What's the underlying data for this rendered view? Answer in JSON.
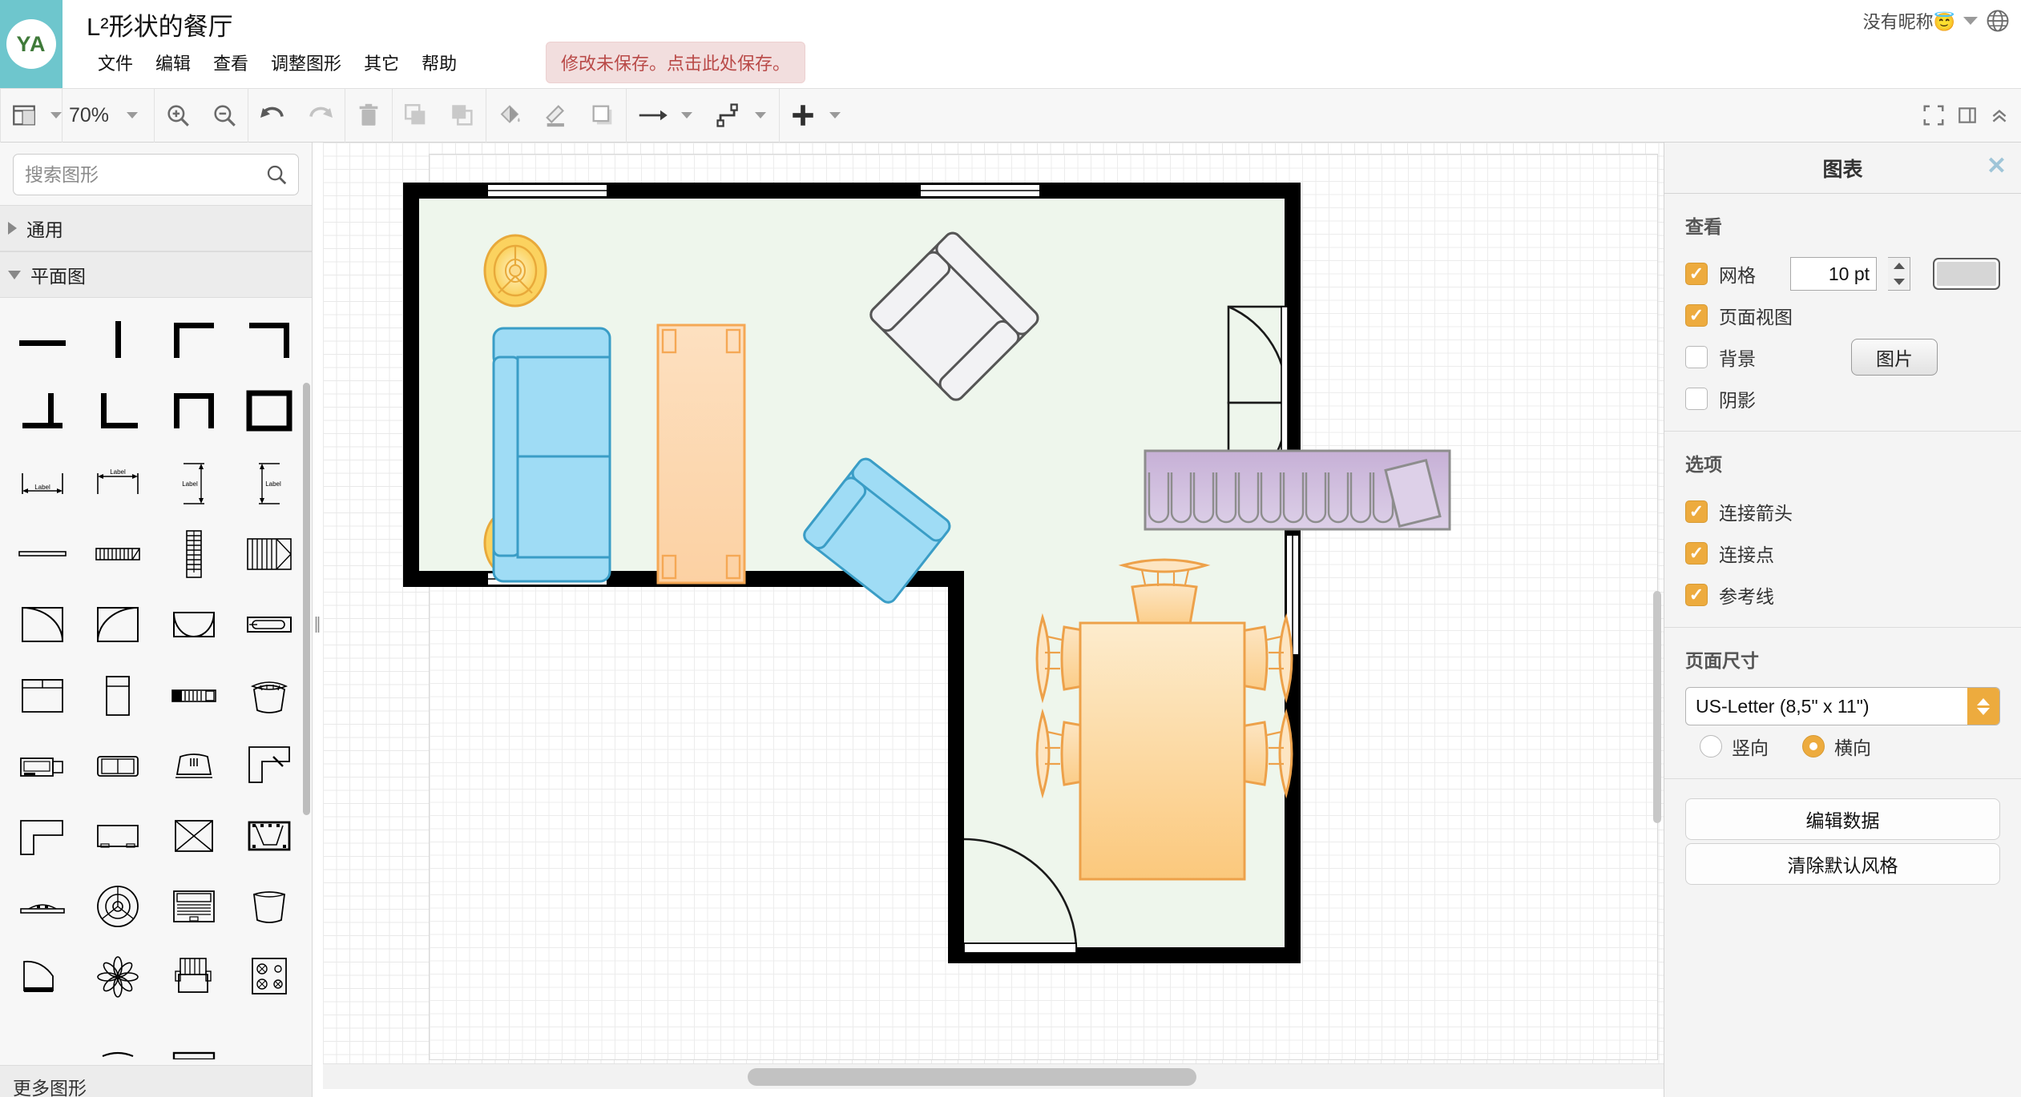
{
  "header": {
    "logo_initials": "YA",
    "doc_title": "L²形状的餐厅",
    "menu": [
      "文件",
      "编辑",
      "查看",
      "调整图形",
      "其它",
      "帮助"
    ],
    "save_notice": "修改未保存。点击此处保存。",
    "user_name": "没有昵称😇"
  },
  "toolbar": {
    "zoom_level": "70%",
    "icons": [
      "view-layout-icon",
      "zoom-in-icon",
      "zoom-out-icon",
      "undo-icon",
      "redo-icon",
      "delete-icon",
      "bring-to-front-icon",
      "send-to-back-icon",
      "fill-color-icon",
      "line-color-icon",
      "shadow-icon",
      "connection-arrow-icon",
      "waypoint-icon",
      "insert-icon",
      "fullscreen-icon",
      "panel-toggle-icon",
      "collapse-icon"
    ]
  },
  "sidebar": {
    "search_placeholder": "搜索图形",
    "sections": [
      {
        "label": "通用",
        "expanded": false
      },
      {
        "label": "平面图",
        "expanded": true
      }
    ],
    "shape_label_text": "Label",
    "footer_label": "更多图形"
  },
  "panel": {
    "title": "图表",
    "view": {
      "heading": "查看",
      "grid": {
        "label": "网格",
        "checked": true,
        "size": "10 pt",
        "color": "#d6d6d6"
      },
      "page_view": {
        "label": "页面视图",
        "checked": true
      },
      "background": {
        "label": "背景",
        "checked": false,
        "button": "图片"
      },
      "shadow": {
        "label": "阴影",
        "checked": false
      }
    },
    "options": {
      "heading": "选项",
      "items": [
        {
          "label": "连接箭头",
          "checked": true
        },
        {
          "label": "连接点",
          "checked": true
        },
        {
          "label": "参考线",
          "checked": true
        }
      ]
    },
    "page_size": {
      "heading": "页面尺寸",
      "selected": "US-Letter (8,5\" x 11\")",
      "orientation": [
        {
          "label": "竖向",
          "selected": false
        },
        {
          "label": "横向",
          "selected": true
        }
      ]
    },
    "actions": [
      "编辑数据",
      "清除默认风格"
    ]
  },
  "colors": {
    "accent": "#edab3e",
    "brand": "#6ec6cd",
    "notice_bg": "#f2dede",
    "notice_text": "#b94a48",
    "room_fill": "#eef6ec",
    "wall": "#000000",
    "sofa_fill": "#9fdcf5",
    "sofa_stroke": "#3a9dc6",
    "table_fill": "#fbd6a6",
    "table_stroke": "#eda14a",
    "closet_fill": "#cfbcd9",
    "closet_stroke": "#8d8d8d",
    "armchair_fill": "#f2f2f4",
    "armchair_stroke": "#555555",
    "fan_fill": "#fddf8a",
    "fan_stroke": "#e8a93a"
  },
  "floorplan": {
    "name": "L-shaped dining room plan",
    "objects": [
      "ceiling-fan-top-left",
      "ceiling-fan-bottom-left",
      "blue-sofa-left",
      "orange-console-table",
      "white-armchair-rotated",
      "blue-armchair-rotated",
      "purple-closet",
      "dining-table",
      "dining-chair-x6",
      "double-door-right",
      "door-bottom-left",
      "window-top-left",
      "window-top-right",
      "window-left-lower",
      "window-right-lower"
    ]
  }
}
